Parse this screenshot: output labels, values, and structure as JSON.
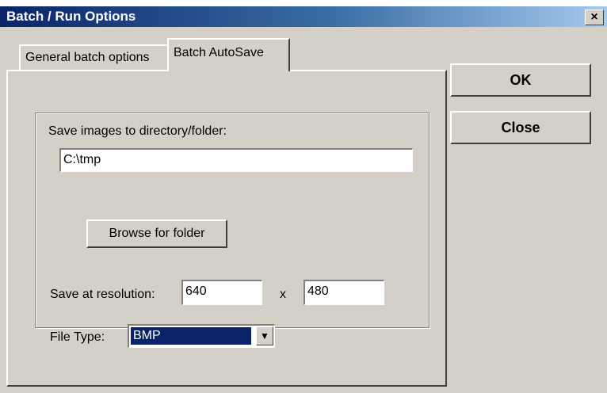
{
  "window": {
    "title": "Batch / Run Options",
    "close_glyph": "×"
  },
  "tabs": [
    {
      "label": "General batch options"
    },
    {
      "label": "Batch AutoSave"
    }
  ],
  "autosave": {
    "directory_label": "Save images to directory/folder:",
    "directory_value": "C:\\tmp",
    "browse_label": "Browse for folder",
    "resolution_label": "Save at resolution:",
    "width_value": "640",
    "times_sign": "x",
    "height_value": "480",
    "filetype_label": "File Type:",
    "filetype_value": "BMP",
    "dropdown_glyph": "▼"
  },
  "buttons": {
    "ok": "OK",
    "close": "Close"
  }
}
